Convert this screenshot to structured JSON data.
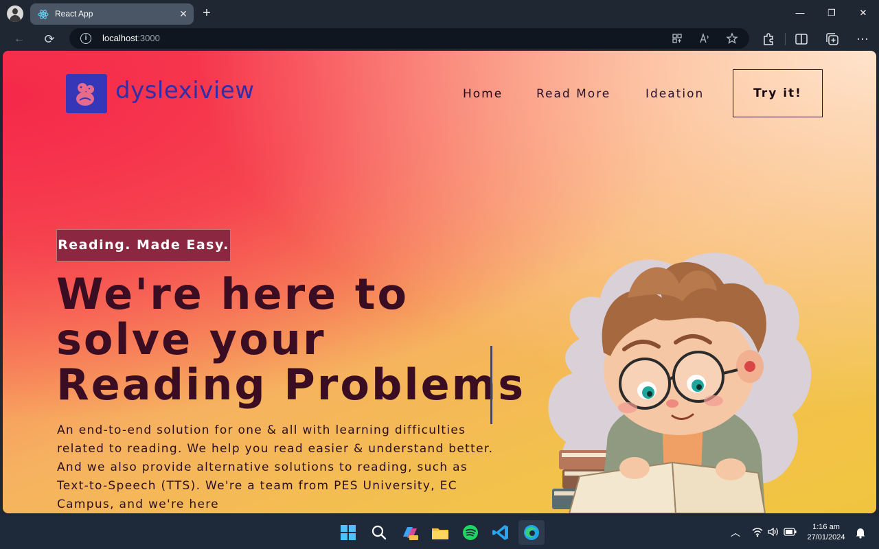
{
  "browser": {
    "tab_title": "React App",
    "tab_close": "✕",
    "new_tab": "+",
    "address_host": "localhost",
    "address_port": ":3000",
    "win_minimize": "—",
    "win_restore": "❐",
    "win_close": "✕",
    "back": "←",
    "refresh": "⟳",
    "info": "i",
    "more": "⋯"
  },
  "site": {
    "logo_text": "dyslexiview",
    "nav": [
      "Home",
      "Read More",
      "Ideation"
    ],
    "cta": "Try it!",
    "tagline": "Reading. Made Easy.",
    "hero_lines": [
      "We're here to",
      "solve your",
      "Reading Problems"
    ],
    "description": "An end-to-end solution for one & all with learning difficulties related to reading. We help you read easier & understand better. And we also provide alternative solutions to reading, such as Text-to-Speech (TTS). We're a team from PES University, EC Campus, and we're here"
  },
  "taskbar": {
    "time": "1:16 am",
    "date": "27/01/2024"
  },
  "colors": {
    "logo_bg": "#3537b8",
    "logo_text": "#2f2fa8",
    "tagline_bg": "#8b2740",
    "hero_text": "#3a0d22"
  },
  "icons": [
    "profile-icon",
    "react-icon",
    "back-icon",
    "refresh-icon",
    "info-icon",
    "app-icon",
    "read-aloud-icon",
    "favorite-icon",
    "extensions-icon",
    "split-screen-icon",
    "collections-icon",
    "more-icon",
    "windows-start-icon",
    "search-icon",
    "copilot-icon",
    "file-explorer-icon",
    "spotify-icon",
    "vscode-icon",
    "edge-icon",
    "chevron-up-icon",
    "wifi-icon",
    "volume-icon",
    "battery-icon",
    "bell-icon"
  ]
}
